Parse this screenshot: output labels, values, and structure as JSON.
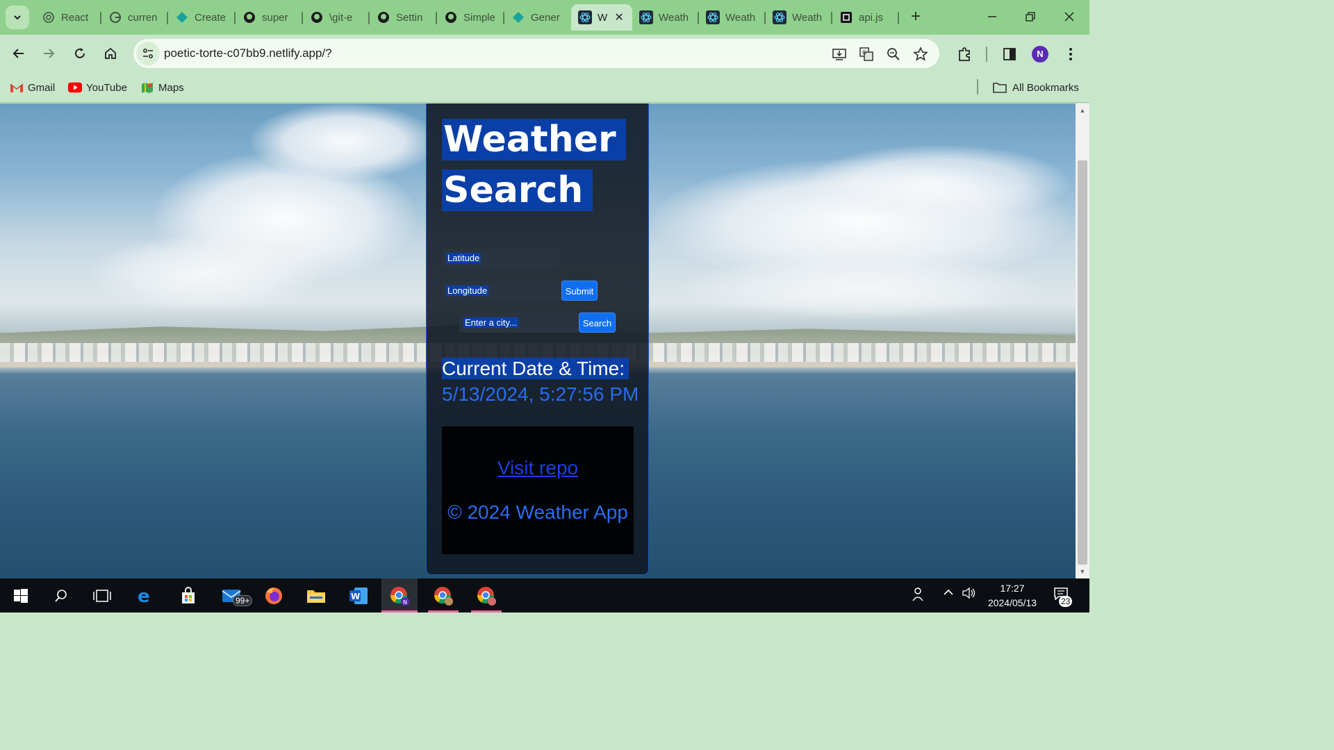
{
  "browser": {
    "tabs": [
      {
        "label": "React",
        "icon": "openai-icon"
      },
      {
        "label": "curren",
        "icon": "google-icon"
      },
      {
        "label": "Create",
        "icon": "netlify-icon"
      },
      {
        "label": "super",
        "icon": "github-icon"
      },
      {
        "label": "\\git-e",
        "icon": "github-icon"
      },
      {
        "label": "Settin",
        "icon": "github-icon"
      },
      {
        "label": "Simple",
        "icon": "github-icon"
      },
      {
        "label": "Gener",
        "icon": "netlify-icon"
      },
      {
        "label": "W",
        "icon": "react-icon",
        "active": true
      },
      {
        "label": "Weath",
        "icon": "react-icon"
      },
      {
        "label": "Weath",
        "icon": "react-icon"
      },
      {
        "label": "Weath",
        "icon": "react-icon"
      },
      {
        "label": "api.js",
        "icon": "square-icon"
      }
    ],
    "url": "poetic-torte-c07bb9.netlify.app/?",
    "profile_initial": "N",
    "bookmarks": [
      {
        "label": "Gmail",
        "icon": "gmail-icon"
      },
      {
        "label": "YouTube",
        "icon": "youtube-icon"
      },
      {
        "label": "Maps",
        "icon": "maps-icon"
      }
    ],
    "all_bookmarks_label": "All Bookmarks"
  },
  "page": {
    "title_line1": "Weather",
    "title_line2": "Search",
    "latitude_placeholder": "Latitude",
    "longitude_placeholder": "Longitude",
    "submit_label": "Submit",
    "city_placeholder": "Enter a city...",
    "search_label": "Search",
    "datetime_label": "Current Date & Time:",
    "datetime_value": "5/13/2024, 5:27:56 PM",
    "repo_link": "Visit repo",
    "copyright": "© 2024 Weather App"
  },
  "taskbar": {
    "mail_badge": "99+",
    "time": "17:27",
    "date": "2024/05/13",
    "notification_count": "23"
  },
  "colors": {
    "browser_frame": "#8fd18c",
    "toolbar": "#c8e6c9",
    "highlight": "#0b3fa8",
    "button": "#0f6ff0",
    "link": "#1a3fe6"
  }
}
